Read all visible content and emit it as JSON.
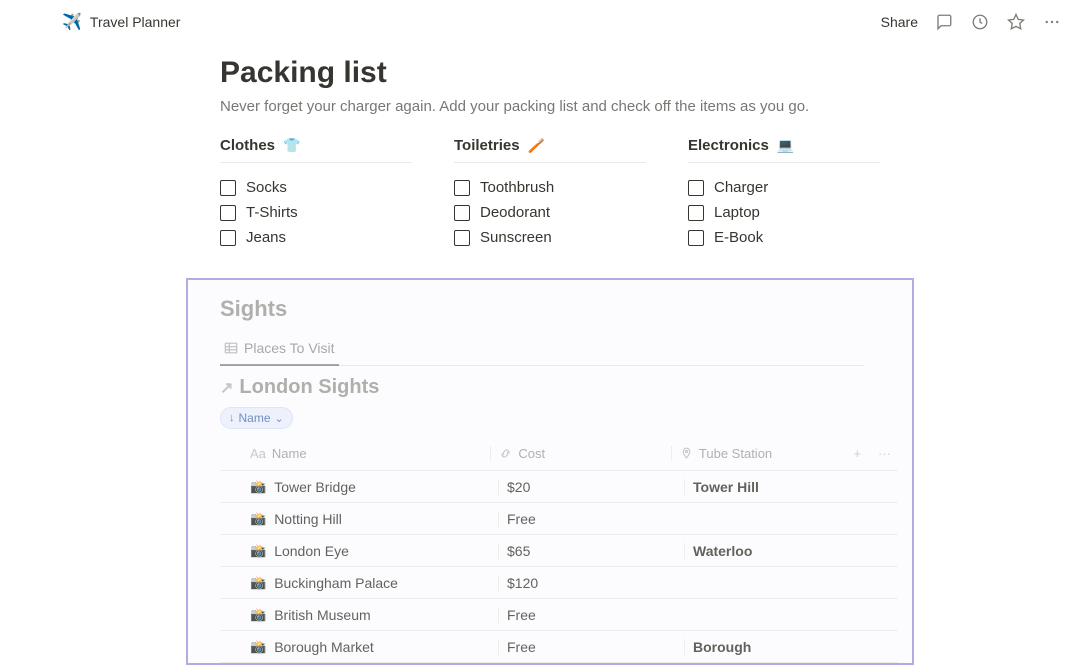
{
  "header": {
    "icon": "✈️",
    "title": "Travel Planner",
    "share": "Share"
  },
  "packing": {
    "heading": "Packing list",
    "subheading": "Never forget your charger again. Add your packing list and check off the items as you go.",
    "columns": [
      {
        "title": "Clothes",
        "emoji": "👕",
        "items": [
          "Socks",
          "T-Shirts",
          "Jeans"
        ]
      },
      {
        "title": "Toiletries",
        "emoji": "🪥",
        "items": [
          "Toothbrush",
          "Deodorant",
          "Sunscreen"
        ]
      },
      {
        "title": "Electronics",
        "emoji": "💻",
        "items": [
          "Charger",
          "Laptop",
          "E-Book"
        ]
      }
    ]
  },
  "sights": {
    "section_title": "Sights",
    "view_tab": "Places To Visit",
    "db_title": "London Sights",
    "sort_label": "Name",
    "columns": {
      "name": "Name",
      "cost": "Cost",
      "tube": "Tube Station"
    },
    "row_emoji": "📸",
    "rows": [
      {
        "name": "Tower Bridge",
        "cost": "$20",
        "tube": "Tower Hill"
      },
      {
        "name": "Notting Hill",
        "cost": "Free",
        "tube": ""
      },
      {
        "name": "London Eye",
        "cost": "$65",
        "tube": "Waterloo"
      },
      {
        "name": "Buckingham Palace",
        "cost": "$120",
        "tube": ""
      },
      {
        "name": "British Museum",
        "cost": "Free",
        "tube": ""
      },
      {
        "name": "Borough Market",
        "cost": "Free",
        "tube": "Borough"
      }
    ]
  }
}
